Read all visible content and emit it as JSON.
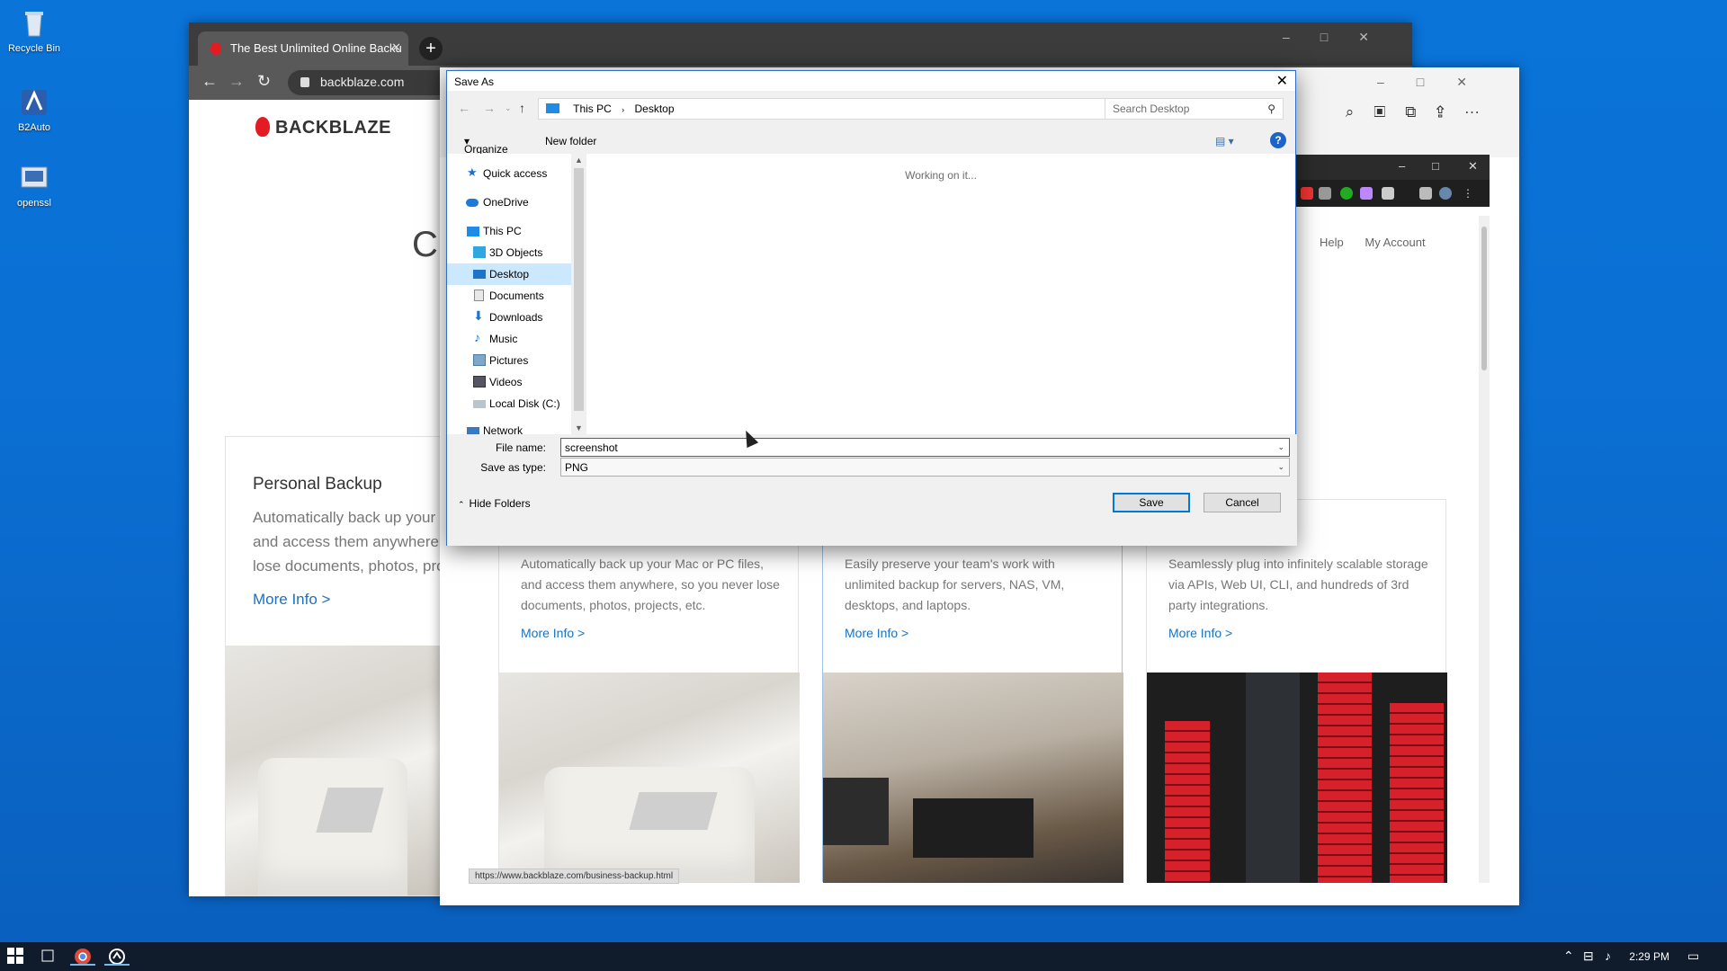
{
  "desktop": {
    "icons": [
      {
        "label": "Recycle Bin"
      },
      {
        "label": "B2Auto"
      },
      {
        "label": "openssl"
      }
    ]
  },
  "chrome": {
    "tab_title": "The Best Unlimited Online Backu",
    "url": "backblaze.com",
    "logo": "BACKBLAZE",
    "hero_partial": "Cl",
    "personal_card": {
      "title": "Personal Backup",
      "lines": [
        "Automatically back up your",
        "and access them anywhere,",
        "lose documents, photos, pro"
      ],
      "link": "More Info >"
    }
  },
  "edge": {
    "nav_links": {
      "help": "Help",
      "account": "My Account"
    },
    "cards": [
      {
        "text": "Automatically back up your Mac or PC files, and access them anywhere, so you never lose documents, photos, projects, etc.",
        "link": "More Info >"
      },
      {
        "text": "Easily preserve your team's work with unlimited backup for servers, NAS, VM, desktops, and laptops.",
        "link": "More Info >"
      },
      {
        "text": "Seamlessly plug into infinitely scalable storage via APIs, Web UI, CLI, and hundreds of 3rd party integrations.",
        "link": "More Info >"
      }
    ],
    "status_url": "https://www.backblaze.com/business-backup.html"
  },
  "dialog": {
    "title": "Save As",
    "breadcrumb": [
      "This PC",
      "Desktop"
    ],
    "search_placeholder": "Search Desktop",
    "organize": "Organize",
    "new_folder": "New folder",
    "nav": {
      "quick_access": "Quick access",
      "onedrive": "OneDrive",
      "this_pc": "This PC",
      "objects3d": "3D Objects",
      "desktop": "Desktop",
      "documents": "Documents",
      "downloads": "Downloads",
      "music": "Music",
      "pictures": "Pictures",
      "videos": "Videos",
      "local_disk": "Local Disk (C:)",
      "network": "Network"
    },
    "working": "Working on it...",
    "file_name_label": "File name:",
    "file_name_value": "screenshot",
    "save_type_label": "Save as type:",
    "save_type_value": "PNG",
    "hide_folders": "Hide Folders",
    "save": "Save",
    "cancel": "Cancel"
  },
  "taskbar": {
    "time": "2:29 PM"
  },
  "colors": {
    "desktop_blue": "#0a74d9",
    "link_blue": "#1a72bf",
    "accent": "#0078d7",
    "brand_red": "#e31b23"
  }
}
